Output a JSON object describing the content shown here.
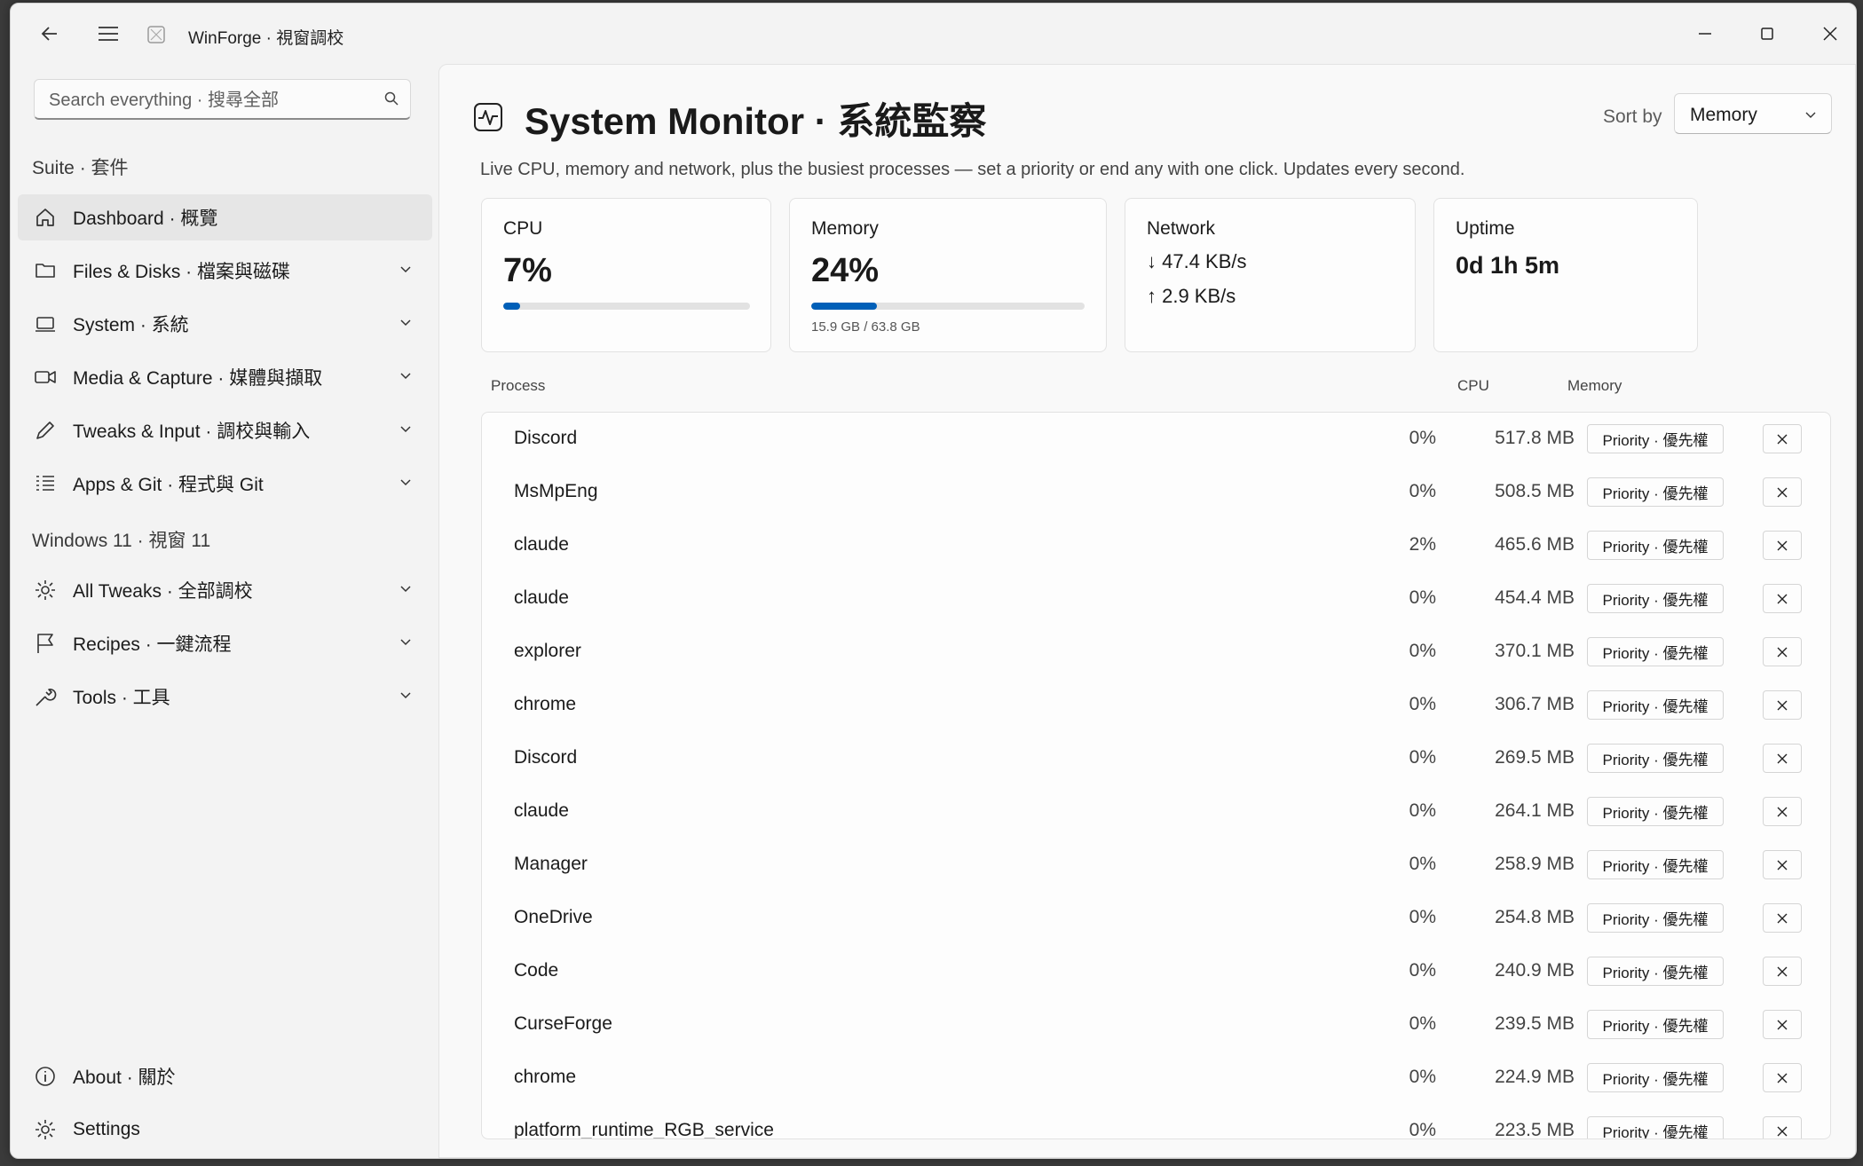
{
  "window": {
    "title": "WinForge · 視窗調校",
    "controls": [
      "minimize-icon",
      "maximize-icon",
      "close-icon"
    ]
  },
  "sidebar": {
    "search_placeholder": "Search everything · 搜尋全部",
    "sections": [
      {
        "header": "Suite · 套件"
      },
      {
        "header": "Windows 11 · 視窗 11"
      }
    ],
    "items": [
      {
        "label": "Dashboard · 概覽",
        "icon": "home-icon",
        "active": true,
        "expandable": false
      },
      {
        "label": "Files & Disks · 檔案與磁碟",
        "icon": "folder-icon",
        "expandable": true
      },
      {
        "label": "System · 系統",
        "icon": "laptop-icon",
        "expandable": true
      },
      {
        "label": "Media & Capture · 媒體與擷取",
        "icon": "video-icon",
        "expandable": true
      },
      {
        "label": "Tweaks & Input · 調校與輸入",
        "icon": "pen-icon",
        "expandable": true
      },
      {
        "label": "Apps & Git · 程式與 Git",
        "icon": "list-icon",
        "expandable": true
      },
      {
        "label": "All Tweaks · 全部調校",
        "icon": "gear-icon",
        "expandable": true
      },
      {
        "label": "Recipes · 一鍵流程",
        "icon": "flag-icon",
        "expandable": true
      },
      {
        "label": "Tools · 工具",
        "icon": "wrench-icon",
        "expandable": true
      }
    ],
    "footer": [
      {
        "label": "About · 關於",
        "icon": "info-icon"
      },
      {
        "label": "Settings",
        "icon": "gear-icon"
      }
    ]
  },
  "main": {
    "title": "System Monitor · 系統監察",
    "subtitle": "Live CPU, memory and network, plus the busiest processes — set a priority or end any with one click. Updates every second.",
    "sort_label": "Sort by",
    "sort_value": "Memory",
    "cards": {
      "cpu": {
        "label": "CPU",
        "value": "7%",
        "fraction": 0.07
      },
      "memory": {
        "label": "Memory",
        "value": "24%",
        "fraction": 0.24,
        "detail": "15.9 GB / 63.8 GB"
      },
      "network": {
        "label": "Network",
        "down": "↓ 47.4 KB/s",
        "up": "↑ 2.9 KB/s"
      },
      "uptime": {
        "label": "Uptime",
        "value": "0d 1h 5m"
      }
    },
    "columns": {
      "process": "Process",
      "cpu": "CPU",
      "memory": "Memory"
    },
    "priority_label": "Priority · 優先權",
    "processes": [
      {
        "name": "Discord",
        "cpu": "0%",
        "mem": "517.8 MB"
      },
      {
        "name": "MsMpEng",
        "cpu": "0%",
        "mem": "508.5 MB"
      },
      {
        "name": "claude",
        "cpu": "2%",
        "mem": "465.6 MB"
      },
      {
        "name": "claude",
        "cpu": "0%",
        "mem": "454.4 MB"
      },
      {
        "name": "explorer",
        "cpu": "0%",
        "mem": "370.1 MB"
      },
      {
        "name": "chrome",
        "cpu": "0%",
        "mem": "306.7 MB"
      },
      {
        "name": "Discord",
        "cpu": "0%",
        "mem": "269.5 MB"
      },
      {
        "name": "claude",
        "cpu": "0%",
        "mem": "264.1 MB"
      },
      {
        "name": "Manager",
        "cpu": "0%",
        "mem": "258.9 MB"
      },
      {
        "name": "OneDrive",
        "cpu": "0%",
        "mem": "254.8 MB"
      },
      {
        "name": "Code",
        "cpu": "0%",
        "mem": "240.9 MB"
      },
      {
        "name": "CurseForge",
        "cpu": "0%",
        "mem": "239.5 MB"
      },
      {
        "name": "chrome",
        "cpu": "0%",
        "mem": "224.9 MB"
      },
      {
        "name": "platform_runtime_RGB_service",
        "cpu": "0%",
        "mem": "223.5 MB"
      }
    ]
  },
  "colors": {
    "accent": "#005fb8",
    "bar_track": "#e2e2e2",
    "active_nav": "#e6e6e6"
  }
}
